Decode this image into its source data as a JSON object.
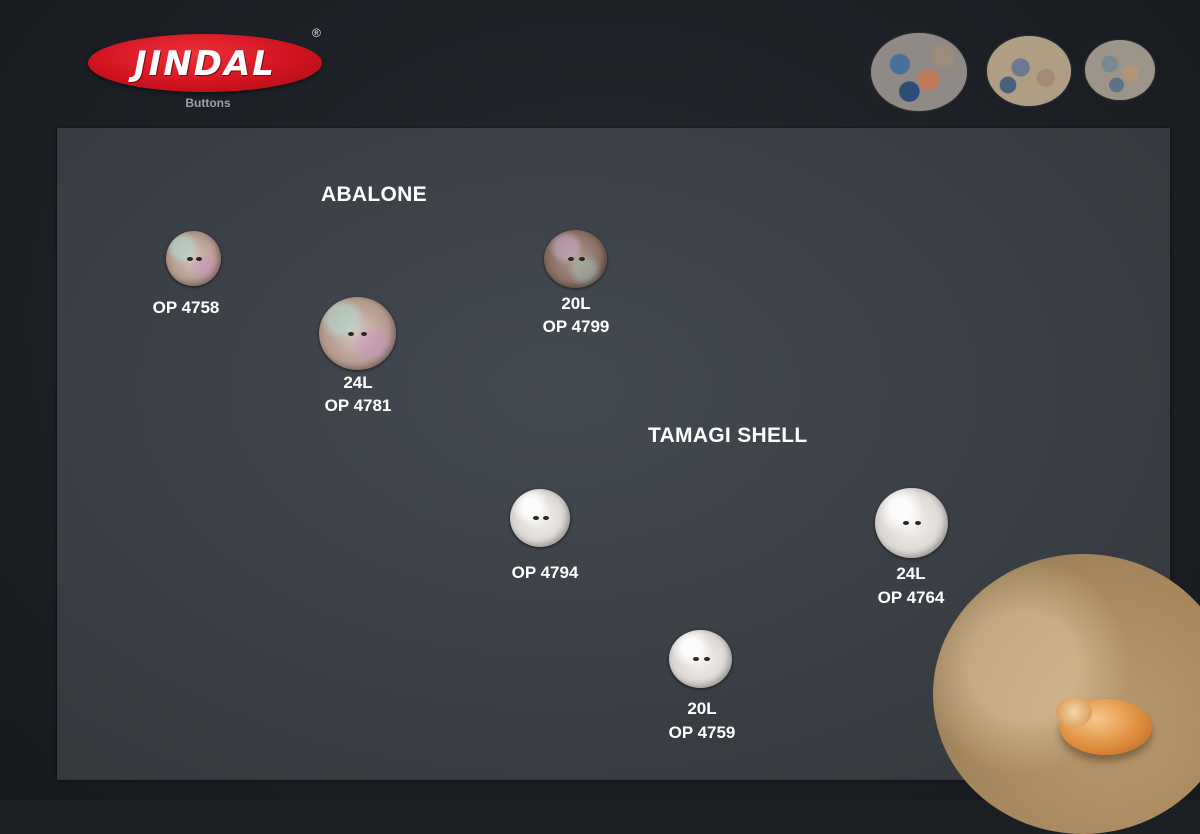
{
  "brand": {
    "name": "JINDAL",
    "registered_mark": "®",
    "subtitle": "Buttons",
    "color": "#d01420"
  },
  "sections": {
    "abalone": {
      "title": "ABALONE"
    },
    "tamagi": {
      "title": "TAMAGI SHELL"
    }
  },
  "products": [
    {
      "size": "",
      "code": "OP 4758",
      "material": "abalone"
    },
    {
      "size": "24L",
      "code": "OP 4781",
      "material": "abalone"
    },
    {
      "size": "20L",
      "code": "OP 4799",
      "material": "abalone"
    },
    {
      "size": "",
      "code": "OP 4794",
      "material": "tamagi shell"
    },
    {
      "size": "24L",
      "code": "OP 4764",
      "material": "tamagi shell"
    },
    {
      "size": "20L",
      "code": "OP 4759",
      "material": "tamagi shell"
    }
  ],
  "colors": {
    "background": "#1b1f24",
    "panel": "#3f444a",
    "text": "#ffffff"
  }
}
